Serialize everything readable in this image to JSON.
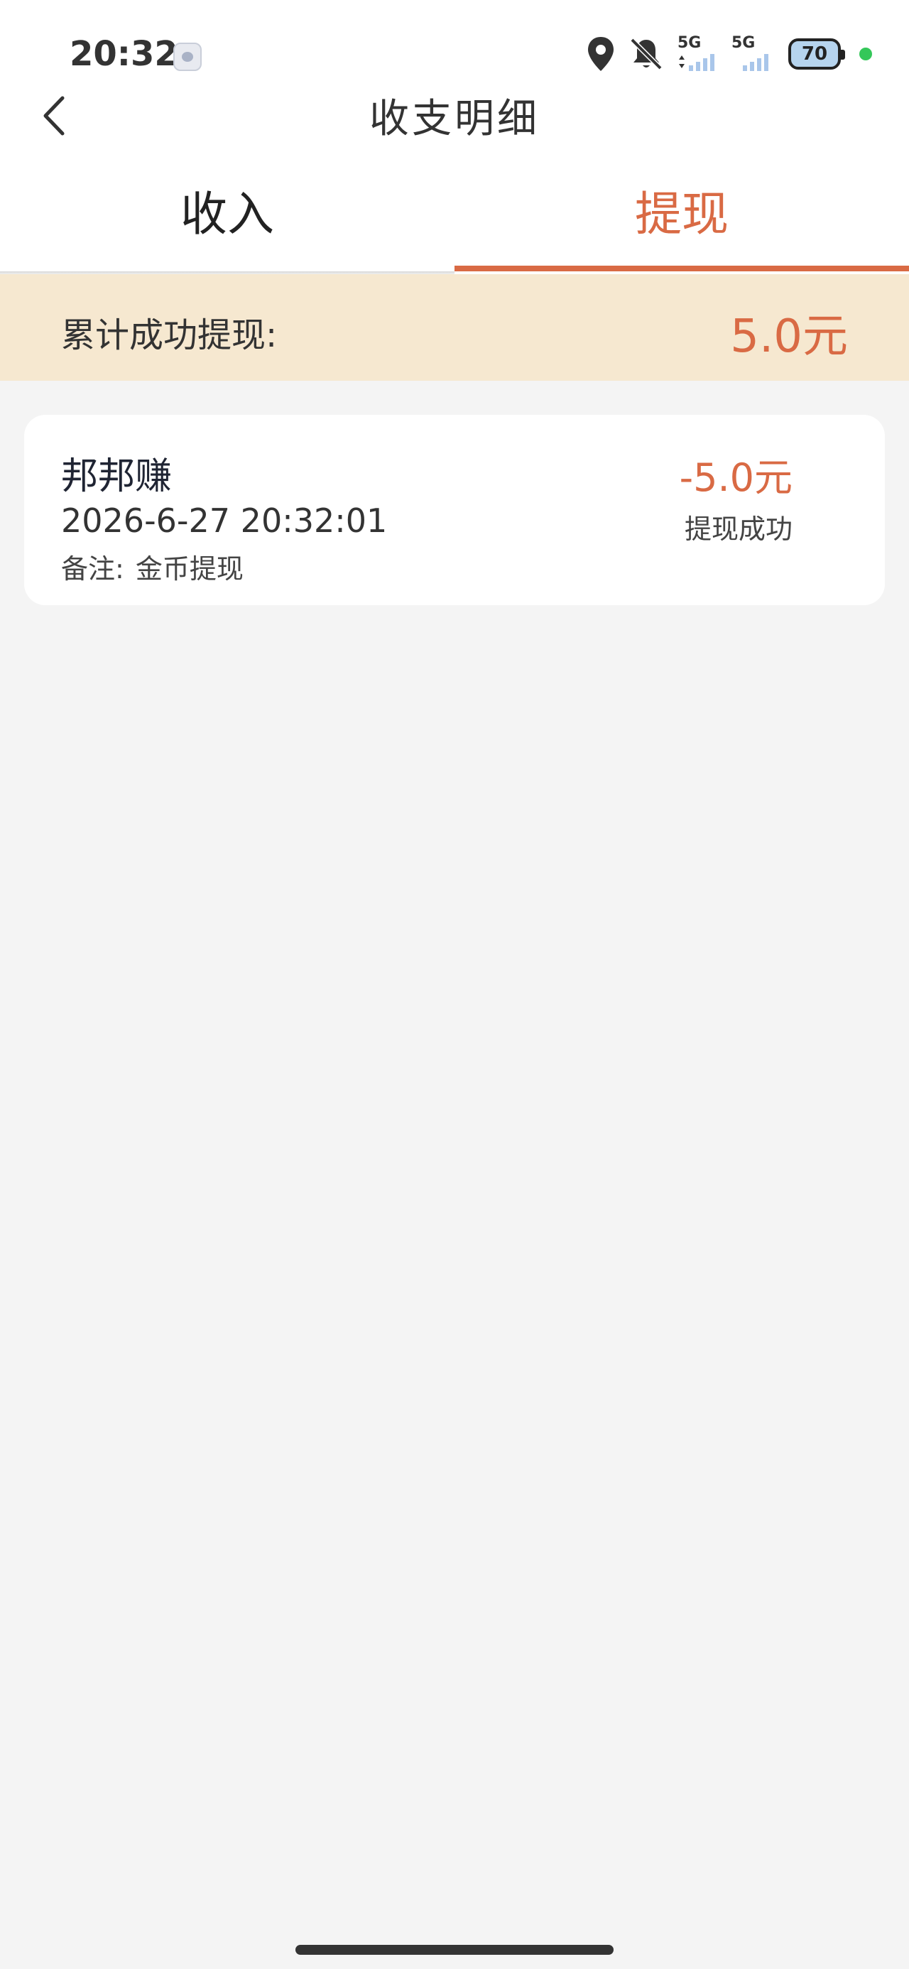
{
  "status_bar": {
    "time": "20:32",
    "network_1": "5G",
    "network_2": "5G",
    "battery": "70",
    "icons": [
      "app-notification-icon",
      "location-icon",
      "mute-icon",
      "signal-icon",
      "signal-icon",
      "battery-icon"
    ],
    "dot_color": "#34c759"
  },
  "header": {
    "title": "收支明细",
    "back_icon": "chevron-left-icon"
  },
  "tabs": [
    {
      "label": "收入",
      "active": false
    },
    {
      "label": "提现",
      "active": true
    }
  ],
  "summary": {
    "label": "累计成功提现:",
    "value": "5.0元"
  },
  "records": [
    {
      "title": "邦邦赚",
      "datetime": "2026-6-27 20:32:01",
      "note_label": "备注:",
      "note_value": "金币提现",
      "amount": "-5.0元",
      "status": "提现成功"
    }
  ],
  "colors": {
    "accent": "#d96a44",
    "banner_bg": "#f6e8d0",
    "page_bg": "#f4f4f4"
  }
}
